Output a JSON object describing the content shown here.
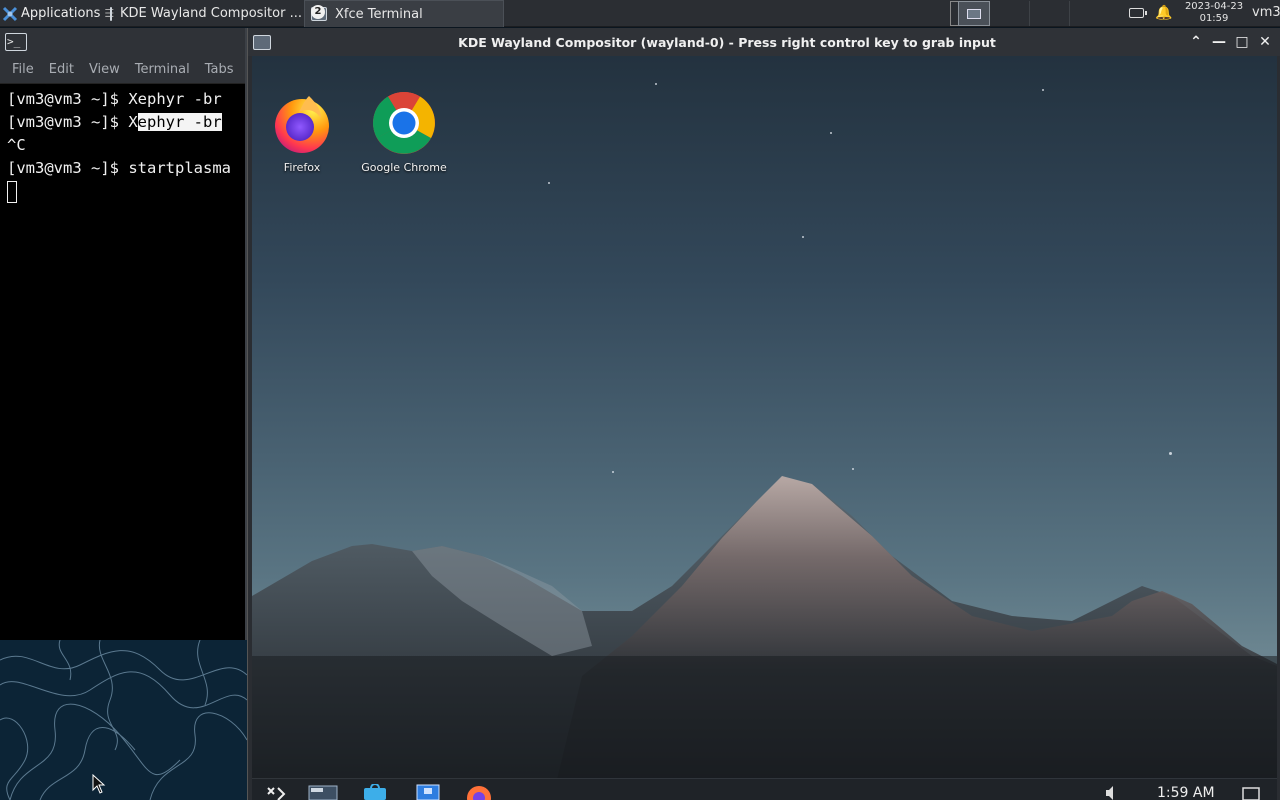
{
  "top_panel": {
    "applications_label": "Applications",
    "menu_separator_glyph": "☰",
    "tasks": [
      {
        "label": "KDE Wayland Compositor ...",
        "icon": "window-icon"
      },
      {
        "label": "Xfce Terminal",
        "icon": "terminal-group-icon",
        "badge": "2"
      }
    ],
    "clock_date": "2023-04-23",
    "clock_time": "01:59",
    "user": "vm3",
    "bell_glyph": "🔔"
  },
  "terminal": {
    "icon_text": ">_",
    "menu": [
      "File",
      "Edit",
      "View",
      "Terminal",
      "Tabs"
    ],
    "lines": [
      {
        "prompt": "[vm3@vm3 ~]$ ",
        "cmd": "Xephyr -br"
      },
      {
        "prompt": "[vm3@vm3 ~]$ ",
        "cmd_plain": "X",
        "cmd_selected": "ephyr -br"
      },
      {
        "text": "^C"
      },
      {
        "prompt": "[vm3@vm3 ~]$ ",
        "cmd": "startplasma"
      }
    ]
  },
  "kde_window": {
    "title": "KDE Wayland Compositor (wayland-0) - Press right control key to grab input",
    "buttons": {
      "shade": "⌃",
      "minimize": "—",
      "maximize": "□",
      "close": "✕"
    },
    "desktop_icons": [
      {
        "label": "Firefox",
        "icon": "firefox-icon"
      },
      {
        "label": "Google Chrome",
        "icon": "chrome-icon"
      }
    ],
    "panel_clock": "1:59 AM"
  },
  "colors": {
    "panel_bg": "#2b2e33",
    "terminal_bg": "#000000",
    "sky_top": "#23323f",
    "sky_bottom": "#6b8590"
  }
}
